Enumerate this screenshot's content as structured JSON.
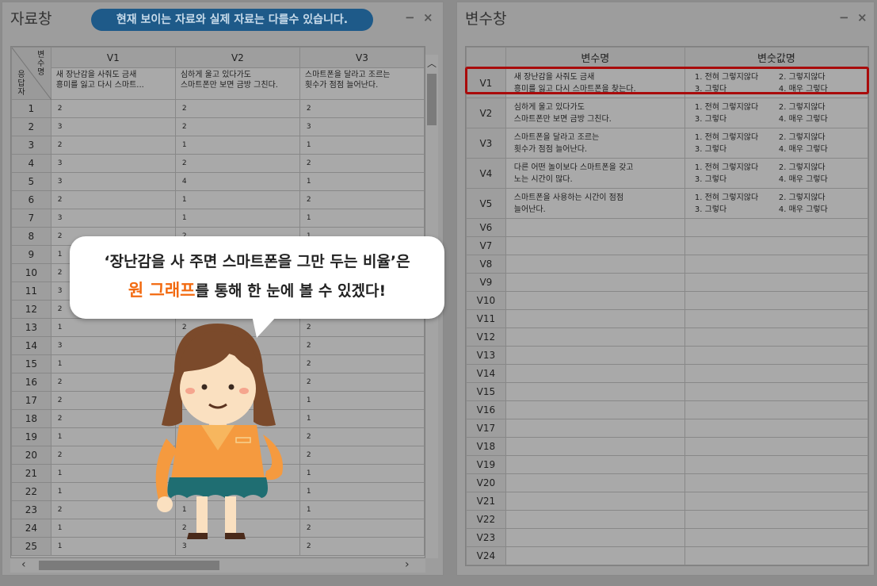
{
  "left_panel": {
    "title": "자료창",
    "notice": "현재 보이는 자료와 실제 자료는 다를수 있습니다.",
    "minimize": "−",
    "close": "×",
    "corner_top": "변수명",
    "corner_bottom": "응답자",
    "columns": [
      {
        "name": "V1",
        "desc1": "새 장난감을 사줘도 금새",
        "desc2": "흥미를 잃고 다시 스마트..."
      },
      {
        "name": "V2",
        "desc1": "심하게 울고 있다가도",
        "desc2": "스마트폰만 보면 금방 그친다."
      },
      {
        "name": "V3",
        "desc1": "스마트폰을 달라고 조르는",
        "desc2": "횟수가 점점 늘어난다."
      }
    ],
    "rows": [
      {
        "n": "1",
        "v1": "2",
        "v2": "2",
        "v3": "2"
      },
      {
        "n": "2",
        "v1": "3",
        "v2": "2",
        "v3": "3"
      },
      {
        "n": "3",
        "v1": "2",
        "v2": "1",
        "v3": "1"
      },
      {
        "n": "4",
        "v1": "3",
        "v2": "2",
        "v3": "2"
      },
      {
        "n": "5",
        "v1": "3",
        "v2": "4",
        "v3": "1"
      },
      {
        "n": "6",
        "v1": "2",
        "v2": "1",
        "v3": "2"
      },
      {
        "n": "7",
        "v1": "3",
        "v2": "1",
        "v3": "1"
      },
      {
        "n": "8",
        "v1": "2",
        "v2": "2",
        "v3": "1"
      },
      {
        "n": "9",
        "v1": "1",
        "v2": "",
        "v3": ""
      },
      {
        "n": "10",
        "v1": "2",
        "v2": "",
        "v3": ""
      },
      {
        "n": "11",
        "v1": "3",
        "v2": "",
        "v3": ""
      },
      {
        "n": "12",
        "v1": "2",
        "v2": "",
        "v3": ""
      },
      {
        "n": "13",
        "v1": "1",
        "v2": "2",
        "v3": "2"
      },
      {
        "n": "14",
        "v1": "3",
        "v2": "",
        "v3": "2"
      },
      {
        "n": "15",
        "v1": "1",
        "v2": "",
        "v3": "2"
      },
      {
        "n": "16",
        "v1": "2",
        "v2": "",
        "v3": "2"
      },
      {
        "n": "17",
        "v1": "2",
        "v2": "",
        "v3": "1"
      },
      {
        "n": "18",
        "v1": "2",
        "v2": "",
        "v3": "1"
      },
      {
        "n": "19",
        "v1": "1",
        "v2": "",
        "v3": "2"
      },
      {
        "n": "20",
        "v1": "2",
        "v2": "",
        "v3": "2"
      },
      {
        "n": "21",
        "v1": "1",
        "v2": "",
        "v3": "1"
      },
      {
        "n": "22",
        "v1": "1",
        "v2": "",
        "v3": "1"
      },
      {
        "n": "23",
        "v1": "2",
        "v2": "1",
        "v3": "1"
      },
      {
        "n": "24",
        "v1": "1",
        "v2": "2",
        "v3": "2"
      },
      {
        "n": "25",
        "v1": "1",
        "v2": "3",
        "v3": "2"
      }
    ]
  },
  "right_panel": {
    "title": "변수창",
    "minimize": "−",
    "close": "×",
    "header_name": "변수명",
    "header_values": "변숫값명",
    "variables": [
      {
        "name": "V1",
        "l1": "새 장난감을 사줘도 금새",
        "l2": "흥미를 잃고 다시 스마트폰을 찾는다."
      },
      {
        "name": "V2",
        "l1": "심하게 울고 있다가도",
        "l2": "스마트폰만 보면 금방 그친다."
      },
      {
        "name": "V3",
        "l1": "스마트폰을 달라고 조르는",
        "l2": "횟수가 점점 늘어난다."
      },
      {
        "name": "V4",
        "l1": "다른 어떤 놀이보다 스마트폰을 갖고",
        "l2": "노는 시간이 많다."
      },
      {
        "name": "V5",
        "l1": "스마트폰을 사용하는 시간이 점점",
        "l2": "늘어난다."
      }
    ],
    "value_labels": [
      "1. 전혀 그렇지않다",
      "2. 그렇지않다",
      "3. 그렇다",
      "4. 매우 그렇다"
    ],
    "empty_vars": [
      "V6",
      "V7",
      "V8",
      "V9",
      "V10",
      "V11",
      "V12",
      "V13",
      "V14",
      "V15",
      "V16",
      "V17",
      "V18",
      "V19",
      "V20",
      "V21",
      "V22",
      "V23",
      "V24"
    ]
  },
  "bubble": {
    "line1": "‘장난감을 사 주면 스마트폰을 그만 두는 비율’은",
    "highlight": "원 그래프",
    "line2_rest": "를 통해 한 눈에 볼 수 있겠다!"
  },
  "colors": {
    "accent": "#f26a10",
    "highlight_border": "#a90b0b",
    "notice_bg": "#1e5a89"
  }
}
